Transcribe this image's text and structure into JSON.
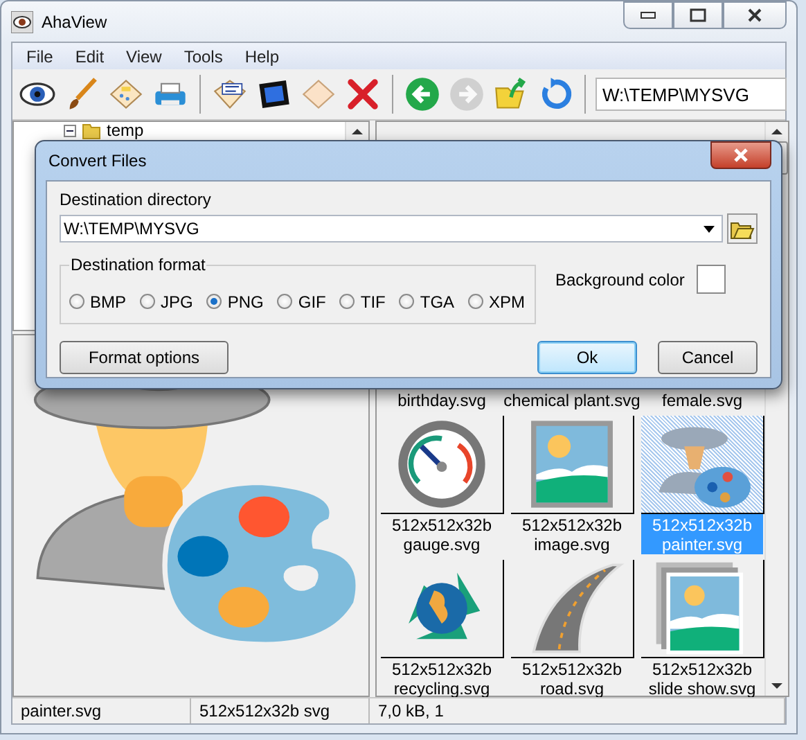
{
  "window": {
    "title": "AhaView"
  },
  "menu": [
    "File",
    "Edit",
    "View",
    "Tools",
    "Help"
  ],
  "toolbar": {
    "buttons": [
      {
        "kind": "view",
        "disabled": false
      },
      {
        "kind": "brush",
        "disabled": false
      },
      {
        "kind": "sheet",
        "disabled": false
      },
      {
        "kind": "print",
        "disabled": false
      },
      {
        "kind": "sep"
      },
      {
        "kind": "rename",
        "disabled": false
      },
      {
        "kind": "film",
        "disabled": false
      },
      {
        "kind": "blank",
        "disabled": false
      },
      {
        "kind": "delete",
        "disabled": false
      },
      {
        "kind": "sep"
      },
      {
        "kind": "back",
        "disabled": false
      },
      {
        "kind": "forward",
        "disabled": true
      },
      {
        "kind": "up",
        "disabled": false
      },
      {
        "kind": "refresh",
        "disabled": false
      },
      {
        "kind": "sep"
      }
    ],
    "path": "W:\\TEMP\\MYSVG"
  },
  "tree": [
    {
      "label": "temp",
      "expanded": true
    }
  ],
  "thumbnails": [
    {
      "name": "birthday.svg",
      "kind": "hidden",
      "selected": false
    },
    {
      "name": "chemical plant.svg",
      "kind": "hidden",
      "selected": false
    },
    {
      "name": "female.svg",
      "kind": "hidden",
      "selected": false
    },
    {
      "size": "512x512x32b",
      "name": "gauge.svg",
      "kind": "gauge",
      "selected": false
    },
    {
      "size": "512x512x32b",
      "name": "image.svg",
      "kind": "image",
      "selected": false
    },
    {
      "size": "512x512x32b",
      "name": "painter.svg",
      "kind": "painter",
      "selected": true
    },
    {
      "size": "512x512x32b",
      "name": "recycling.svg",
      "kind": "recycling",
      "selected": false
    },
    {
      "size": "512x512x32b",
      "name": "road.svg",
      "kind": "road",
      "selected": false
    },
    {
      "size": "512x512x32b",
      "name": "slide show.svg",
      "kind": "slideshow",
      "selected": false
    }
  ],
  "status_bar": [
    "painter.svg",
    "512x512x32b svg",
    "7,0 kB, 1"
  ],
  "dialog": {
    "title": "Convert Files",
    "directory_label": "Destination directory",
    "directory": "W:\\TEMP\\MYSVG",
    "format_label": "Destination format",
    "formats": [
      {
        "label": "BMP",
        "selected": false
      },
      {
        "label": "JPG",
        "selected": false
      },
      {
        "label": "PNG",
        "selected": true
      },
      {
        "label": "GIF",
        "selected": false
      },
      {
        "label": "TIF",
        "selected": false
      },
      {
        "label": "TGA",
        "selected": false
      },
      {
        "label": "XPM",
        "selected": false
      }
    ],
    "background_label": "Background color",
    "buttons": [
      {
        "label": "Format options",
        "default": false
      },
      {
        "label": "Ok",
        "default": true
      },
      {
        "label": "Cancel",
        "default": false
      }
    ]
  }
}
